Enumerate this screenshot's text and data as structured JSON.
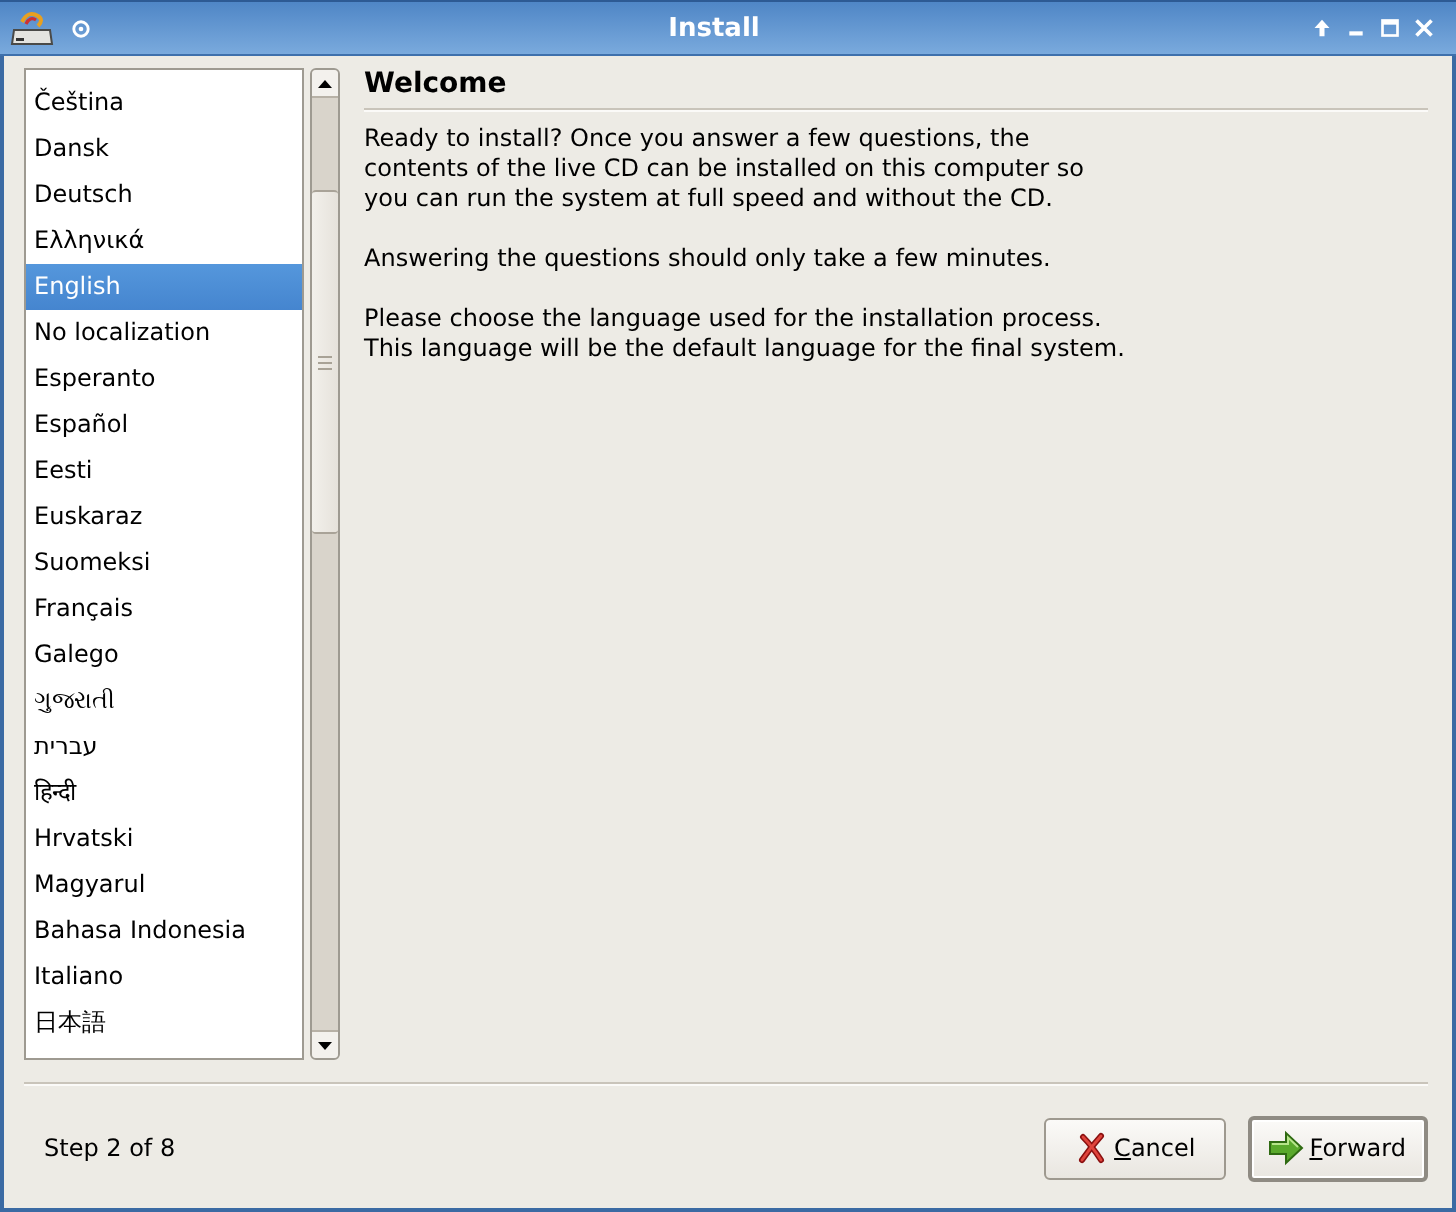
{
  "window": {
    "title": "Install"
  },
  "languages": [
    {
      "name": "Čeština",
      "selected": false
    },
    {
      "name": "Dansk",
      "selected": false
    },
    {
      "name": "Deutsch",
      "selected": false
    },
    {
      "name": "Ελληνικά",
      "selected": false
    },
    {
      "name": "English",
      "selected": true
    },
    {
      "name": "No localization",
      "selected": false
    },
    {
      "name": "Esperanto",
      "selected": false
    },
    {
      "name": "Español",
      "selected": false
    },
    {
      "name": "Eesti",
      "selected": false
    },
    {
      "name": "Euskaraz",
      "selected": false
    },
    {
      "name": "Suomeksi",
      "selected": false
    },
    {
      "name": "Français",
      "selected": false
    },
    {
      "name": "Galego",
      "selected": false
    },
    {
      "name": "ગુજરાતી",
      "selected": false
    },
    {
      "name": "עברית",
      "selected": false
    },
    {
      "name": "हिन्दी",
      "selected": false
    },
    {
      "name": "Hrvatski",
      "selected": false
    },
    {
      "name": "Magyarul",
      "selected": false
    },
    {
      "name": "Bahasa Indonesia",
      "selected": false
    },
    {
      "name": "Italiano",
      "selected": false
    },
    {
      "name": "日本語",
      "selected": false
    }
  ],
  "page": {
    "heading": "Welcome",
    "paragraphs": [
      "Ready to install? Once you answer a few questions, the\ncontents of the live CD can be installed on this computer so\nyou can run the system at full speed and without the CD.",
      "Answering the questions should only take a few minutes.",
      "Please choose the language used for the installation process.\nThis language will be the default language for the final system."
    ]
  },
  "status": "Step 2 of 8",
  "buttons": [
    {
      "kind": "cancel",
      "label": "Cancel",
      "default": false
    },
    {
      "kind": "forward",
      "label": "Forward",
      "default": true
    }
  ]
}
